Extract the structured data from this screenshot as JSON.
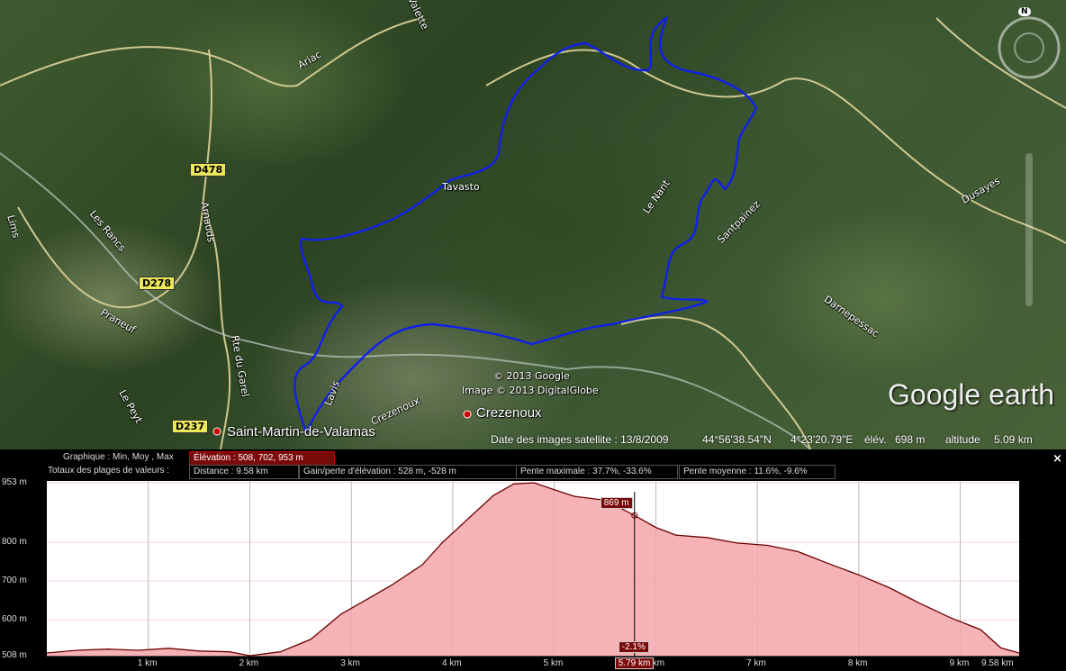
{
  "map": {
    "places": [
      {
        "text": "Saint-Martin-de-Valamas",
        "big": true
      },
      {
        "text": "Crezenoux",
        "big": true
      },
      {
        "text": "Tavasto"
      },
      {
        "text": "Le Nant"
      },
      {
        "text": "Santpainez"
      },
      {
        "text": "Darnepessac"
      },
      {
        "text": "Dusayes"
      },
      {
        "text": "Ariac"
      },
      {
        "text": "Valette"
      },
      {
        "text": "Les Rancs"
      },
      {
        "text": "Praneuf"
      },
      {
        "text": "Lavis"
      },
      {
        "text": "Crezenoux"
      },
      {
        "text": "Le Peyt"
      },
      {
        "text": "Rte du Garel"
      },
      {
        "text": "Arnauds"
      },
      {
        "text": "Lims"
      }
    ],
    "roads": [
      "D478",
      "D278",
      "D237"
    ],
    "copyright1": "© 2013 Google",
    "copyright2": "Image © 2013 DigitalGlobe",
    "brand": "Google earth",
    "compass": "N",
    "status": {
      "date": "Date des images satellite : 13/8/2009",
      "lat": "44°56'38.54\"N",
      "lon": "4°23'20.79\"E",
      "elev_label": "élév.",
      "elev": "698 m",
      "alt_label": "altitude",
      "alt": "5.09 km"
    }
  },
  "profile": {
    "close": "×",
    "graph_label": "Graphique : Min, Moy , Max",
    "elevation_stat": "Élévation : 508, 702, 953 m",
    "totals_label": "Totaux des plages de valeurs :",
    "distance": "Distance : 9.58 km",
    "gain": "Gain/perte d'élévation : 528 m, -528 m",
    "max_slope": "Pente maximale : 37.7%, -33.6%",
    "avg_slope": "Pente moyenne : 11.6%, -9.6%",
    "cursor_elev": "869 m",
    "cursor_slope": "-2.1%",
    "cursor_dist": "5.79 km",
    "end_dist": "9.58 km",
    "line_color": "#6b0000",
    "fill_color": "#f4a6aa"
  },
  "chart_data": {
    "type": "area",
    "title": "",
    "xlabel": "",
    "ylabel": "",
    "x_unit": "km",
    "y_unit": "m",
    "xlim": [
      0,
      9.58
    ],
    "ylim": [
      508,
      953
    ],
    "x_ticks": [
      "1 km",
      "2 km",
      "3 km",
      "4 km",
      "5 km",
      "6 km",
      "7 km",
      "8 km",
      "9 km"
    ],
    "y_ticks": [
      "508 m",
      "600 m",
      "700 m",
      "800 m",
      "953 m"
    ],
    "y_tick_values": [
      508,
      600,
      700,
      800,
      953
    ],
    "grid": true,
    "cursor": {
      "x": 5.79,
      "y": 869
    },
    "x": [
      0,
      0.3,
      0.6,
      0.9,
      1.2,
      1.5,
      1.8,
      2.0,
      2.3,
      2.6,
      2.9,
      3.1,
      3.4,
      3.7,
      3.9,
      4.2,
      4.4,
      4.6,
      4.8,
      5.0,
      5.2,
      5.5,
      5.79,
      6.0,
      6.2,
      6.5,
      6.8,
      7.1,
      7.4,
      7.7,
      8.0,
      8.3,
      8.6,
      8.9,
      9.2,
      9.4,
      9.58
    ],
    "y": [
      515,
      522,
      525,
      522,
      527,
      520,
      518,
      508,
      518,
      550,
      615,
      645,
      690,
      742,
      800,
      872,
      920,
      950,
      953,
      935,
      918,
      908,
      869,
      838,
      818,
      812,
      798,
      792,
      776,
      745,
      716,
      683,
      643,
      606,
      575,
      528,
      515
    ]
  }
}
